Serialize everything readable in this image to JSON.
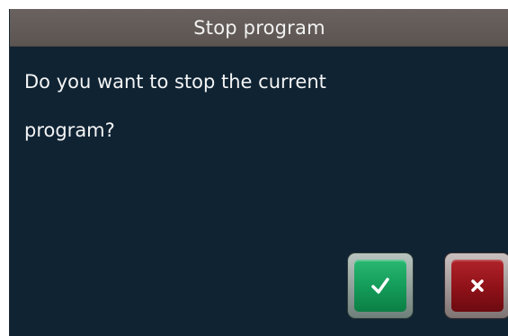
{
  "dialog": {
    "title": "Stop program",
    "message": "Do you want to stop the current program?"
  },
  "buttons": {
    "confirm_icon": "checkmark-icon",
    "cancel_icon": "close-icon"
  },
  "colors": {
    "title_bar": "#5f5855",
    "dialog_background": "#0f2333",
    "confirm": "#13a05c",
    "cancel": "#9a141b"
  }
}
